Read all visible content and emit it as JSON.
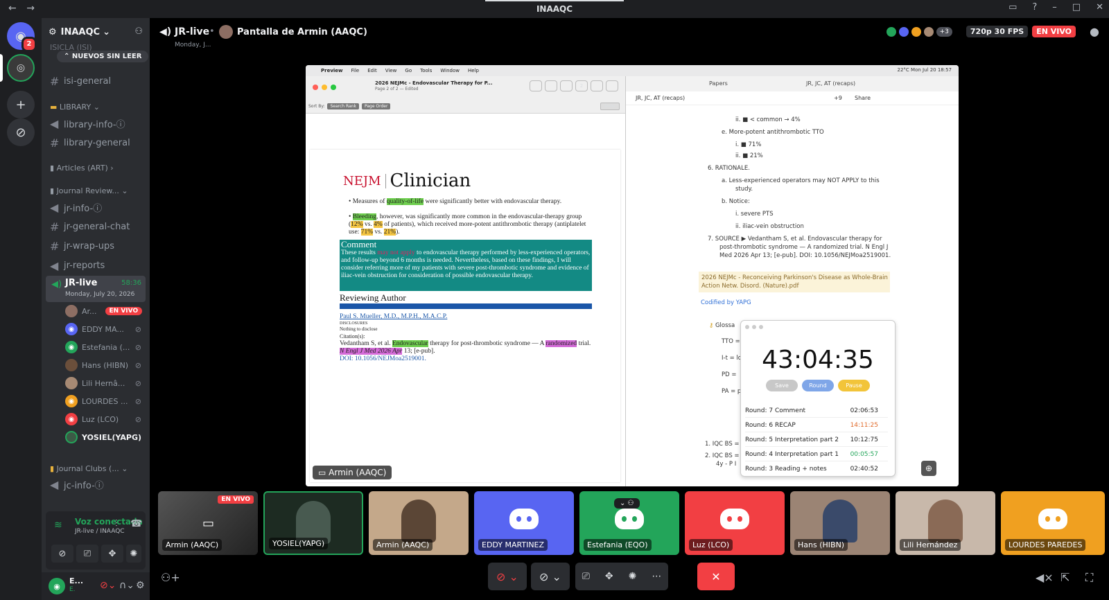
{
  "window": {
    "title": "INAAQC",
    "back": "←",
    "forward": "→"
  },
  "rail": {
    "home_badge": "2"
  },
  "server": {
    "name": "INAAQC",
    "unread_pill": "NUEVOS SIN LEER"
  },
  "channels": {
    "cut_top": "ISICLA (ISI)",
    "isi_general": "isi-general",
    "library_cat": "LIBRARY",
    "library_info": "library-info-ⓘ",
    "library_general": "library-general",
    "articles_cat": "Articles (ART)",
    "journal_cat": "Journal Review...",
    "jr_info": "jr-info-ⓘ",
    "jr_general_chat": "jr-general-chat",
    "jr_wrap_ups": "jr-wrap-ups",
    "jr_reports": "jr-reports",
    "jr_live": "JR-live",
    "jr_live_time": "58:36",
    "jr_live_date": "Monday, July 20, 2026",
    "clubs_cat": "Journal Clubs (...",
    "jc_info": "jc-info-ⓘ"
  },
  "voice_users": [
    {
      "name": "Ar...",
      "live": "EN VIVO"
    },
    {
      "name": "EDDY MA..."
    },
    {
      "name": "Estefania (..."
    },
    {
      "name": "Hans (HIBN)"
    },
    {
      "name": "Lili Hernâ..."
    },
    {
      "name": "LOURDES ..."
    },
    {
      "name": "Luz (LCO)"
    },
    {
      "name": "YOSIEL(YAPG)"
    }
  ],
  "voice_panel": {
    "status": "Voz conectada",
    "location": "JR-live / INAAQC"
  },
  "user_panel": {
    "name": "E...",
    "status": "E."
  },
  "stage": {
    "channel": "JR-live",
    "subtitle": "Monday, J...",
    "sharer": "Pantalla de Armin (AAQC)",
    "extra_count": "+3",
    "quality": "720p 30 FPS",
    "live": "EN VIVO",
    "stream_label": "Armin (AAQC)"
  },
  "preview": {
    "menu": [
      "Preview",
      "File",
      "Edit",
      "View",
      "Go",
      "Tools",
      "Window",
      "Help"
    ],
    "menubar_right": "22°C   Mon Jul 20  18:57",
    "title": "2026 NEJMc - Endovascular Therapy for P...",
    "subtitle": "Page 2 of 2 — Edited",
    "page_num": "2",
    "sort_by": "Sort By:",
    "sort_rank": "Search Rank",
    "sort_order": "Page Order",
    "done": "Done",
    "logo": "NEJM",
    "clinician": "Clinician",
    "b1_a": "Measures of ",
    "b1_h": "quality-of-life",
    "b1_b": " were significantly better with endovascular therapy.",
    "b2_h": "Bleeding",
    "b2_a": ", however, was significantly more common in the endovascular-therapy group (",
    "b2_p1": "12%",
    "b2_b": " vs. ",
    "b2_p2": "4%",
    "b2_c": " of patients), which received more-potent antithrombotic therapy (antiplatelet use: ",
    "b2_p3": "71%",
    "b2_d": " vs. ",
    "b2_p4": "21%",
    "b2_e": ").",
    "comment_head": "Comment",
    "comment_a": "These results ",
    "comment_r": "may not apply",
    "comment_b": " to endovascular therapy performed by less-experienced operators, and follow-up beyond 6 months is needed. Nevertheless, based on these findings, I will consider referring more of my patients with severe post-thrombotic syndrome and evidence of iliac-vein obstruction for consideration of possible endovascular therapy.",
    "reviewing_author": "Reviewing Author",
    "author": "Paul S. Mueller, M.D., M.P.H., M.A.C.P.",
    "disclosures": "DISCLOSURES",
    "disclose_text": "Nothing to disclose",
    "citation_label": "Citation(s):",
    "cite_a": "Vedantham S, et al. ",
    "cite_h1": "Endovascular",
    "cite_b": " therapy for post-thrombotic syndrome — A ",
    "cite_h2": "randomized",
    "cite_c": " trial. ",
    "cite_h3": "N Engl J Med 2026 Apr",
    "cite_d": " 13; [e-pub].",
    "doi": "DOI: 10.1056/NEJMoa2519001."
  },
  "notes": {
    "tab1": "Papers",
    "tab2": "JR, JC, AT (recaps)",
    "page_title": "JR, JC, AT (recaps)",
    "plus9": "+9",
    "share": "Share",
    "l1": "ii.  ■ < common → 4%",
    "l2": "e.  More-potent antithrombotic TTO",
    "l3": "i.  ■ 71%",
    "l4": "ii.  ■ 21%",
    "l5": "6.  RATIONALE.",
    "l6": "a.  Less-experienced operators may NOT APPLY to this",
    "l6b": "study.",
    "l7": "b.  Notice:",
    "l8": "i.  severe PTS",
    "l9": "ii.  iliac-vein obstruction",
    "l10": "7.  SOURCE ▶ Vedantham S, et al. Endovascular therapy for",
    "l10b": "post-thrombotic syndrome — A randomized trial. N Engl J",
    "l10c": "Med 2026 Apr 13; [e-pub]. DOI: 10.1056/NEJMoa2519001.",
    "y1": "2026 NEJMc - Reconceiving Parkinson's Disease as Whole-Brain",
    "y2": "Action Netw. Disord. (Nature).pdf",
    "codified": "Codified by YAPG",
    "glossary": "Glossa",
    "g1": "TTO =",
    "g2": "I-t = lo",
    "g3": "PD =",
    "g4": "PA = pl",
    "n1": "1.  IQC BS =",
    "n2": "2.  IQC BS =",
    "n2b": "4y - P I"
  },
  "timer": {
    "clock": "43:04:35",
    "save": "Save",
    "round": "Round",
    "pause": "Pause",
    "rows": [
      {
        "label": "Round: 7  Comment",
        "time": "02:06:53"
      },
      {
        "label": "Round: 6  RECAP",
        "time": "14:11:25"
      },
      {
        "label": "Round: 5  Interpretation part 2",
        "time": "10:12:75"
      },
      {
        "label": "Round: 4  Interpretation part 1",
        "time": "00:05:57"
      },
      {
        "label": "Round: 3  Reading + notes",
        "time": "02:40:52"
      }
    ]
  },
  "tiles": [
    {
      "name": "Armin (AAQC)",
      "live": "EN VIVO"
    },
    {
      "name": "YOSIEL(YAPG)"
    },
    {
      "name": "Armin (AAQC)"
    },
    {
      "name": "EDDY MARTINEZ"
    },
    {
      "name": "Estefania (EQO)"
    },
    {
      "name": "Luz (LCO)"
    },
    {
      "name": "Hans (HIBN)"
    },
    {
      "name": "Lili Hernández"
    },
    {
      "name": "LOURDES PAREDES"
    }
  ],
  "colors": {
    "discord_bg": "#2b2d31",
    "live_red": "#f23f43",
    "voice_green": "#23a55a",
    "blurple": "#5865f2",
    "teal_comment": "#138a84"
  }
}
